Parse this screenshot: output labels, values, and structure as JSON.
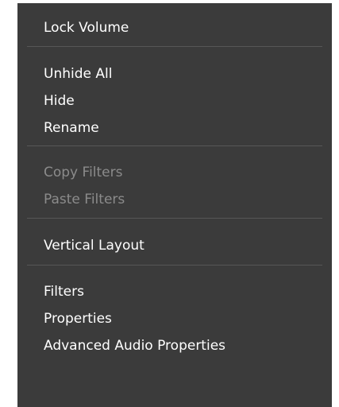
{
  "context_menu": {
    "groups": [
      {
        "items": [
          {
            "label": "Lock Volume",
            "enabled": true
          }
        ]
      },
      {
        "items": [
          {
            "label": "Unhide All",
            "enabled": true
          },
          {
            "label": "Hide",
            "enabled": true
          },
          {
            "label": "Rename",
            "enabled": true
          }
        ]
      },
      {
        "items": [
          {
            "label": "Copy Filters",
            "enabled": false
          },
          {
            "label": "Paste Filters",
            "enabled": false
          }
        ]
      },
      {
        "items": [
          {
            "label": "Vertical Layout",
            "enabled": true
          }
        ]
      },
      {
        "items": [
          {
            "label": "Filters",
            "enabled": true
          },
          {
            "label": "Properties",
            "enabled": true
          },
          {
            "label": "Advanced Audio Properties",
            "enabled": true
          }
        ]
      }
    ],
    "colors": {
      "background": "#3b3b3b",
      "text": "#ffffff",
      "disabled_text": "#8b8b8b",
      "separator": "#575757"
    }
  }
}
